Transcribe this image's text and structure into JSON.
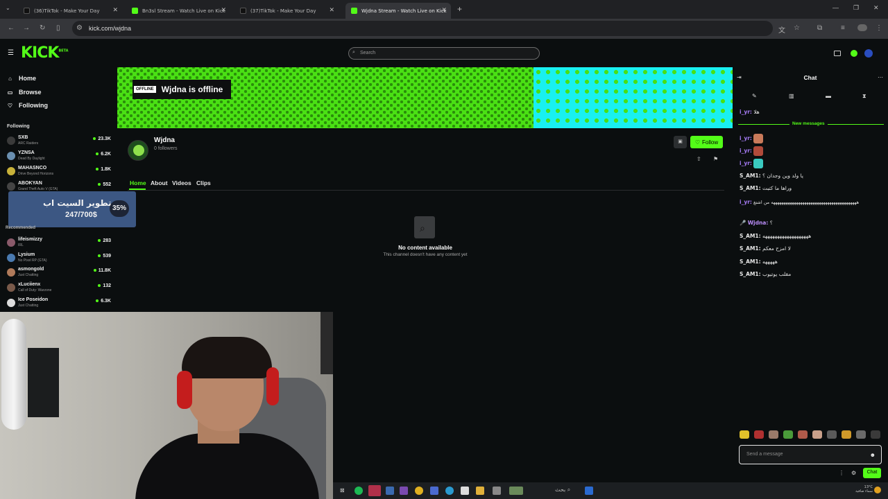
{
  "browser": {
    "tabs": [
      {
        "title": "(36)TikTok - Make Your Day"
      },
      {
        "title": "Bn3sl Stream - Watch Live on Kick"
      },
      {
        "title": "(37)TikTok - Make Your Day"
      },
      {
        "title": "Wjdna Stream - Watch Live on Kick"
      }
    ],
    "url": "kick.com/wjdna"
  },
  "kick": {
    "logo": "KICK",
    "logo_beta": "BETA",
    "search_placeholder": "Search",
    "nav": [
      {
        "label": "Home",
        "icon": "home-icon"
      },
      {
        "label": "Browse",
        "icon": "browse-icon"
      },
      {
        "label": "Following",
        "icon": "heart-icon"
      }
    ],
    "following_heading": "Following",
    "following": [
      {
        "name": "SXB",
        "game": "ARC Raiders",
        "viewers": "23.3K",
        "color": "#3a3a3a"
      },
      {
        "name": "YZNSA",
        "game": "Dead By Daylight",
        "viewers": "6.2K",
        "color": "#6a8fb0"
      },
      {
        "name": "MAHASNCO",
        "game": "Drive Beyond Horizons",
        "viewers": "1.8K",
        "color": "#c8b23a"
      },
      {
        "name": "ABOKYAN",
        "game": "Grand Theft Auto V (GTA)",
        "viewers": "552",
        "color": "#444"
      }
    ],
    "donation": {
      "title": "تطوير السيت اب",
      "amount": "247/700$",
      "percent": "35%",
      "progress": 0.35
    },
    "recommended_heading": "Recommended",
    "recommended": [
      {
        "name": "lifeismizzy",
        "game": "IRL",
        "viewers": "283",
        "color": "#8a5a6a"
      },
      {
        "name": "Lysium",
        "game": "No Pixel RP (GTA)",
        "viewers": "539",
        "color": "#4a7ab0"
      },
      {
        "name": "asmongold",
        "game": "Just Chatting",
        "viewers": "11.8K",
        "color": "#b07a5a"
      },
      {
        "name": "xLuciienx",
        "game": "Call of Duty: Warzone",
        "viewers": "132",
        "color": "#7a5a4a"
      },
      {
        "name": "Ice Poseidon",
        "game": "Just Chatting",
        "viewers": "6.3K",
        "color": "#ddd"
      }
    ],
    "banner": {
      "badge": "OFFLINE",
      "title": "Wjdna is offline"
    },
    "channel": {
      "name": "Wjdna",
      "followers": "0 followers",
      "follow_label": "Follow"
    },
    "channel_tabs": [
      "Home",
      "About",
      "Videos",
      "Clips"
    ],
    "empty": {
      "title": "No content available",
      "subtitle": "This channel doesn't have any content yet"
    }
  },
  "chat": {
    "title": "Chat",
    "new_messages_label": "New messages",
    "messages": [
      {
        "user": "i_yr:",
        "text": "هلا",
        "color": "#a67cf7"
      },
      {
        "user": "i_yr:",
        "text": "",
        "color": "#a67cf7",
        "emote": "#c97a5a"
      },
      {
        "user": "i_yr:",
        "text": "",
        "color": "#a67cf7",
        "emote": "#b04a3a"
      },
      {
        "user": "i_yr:",
        "text": "",
        "color": "#a67cf7",
        "emote": "#3ac9c0"
      },
      {
        "user": "S_AM1:",
        "text": "يا ولد وين وجدان ؟",
        "color": "#e6e6e6"
      },
      {
        "user": "S_AM1:",
        "text": "وراها ما كتبت",
        "color": "#e6e6e6"
      },
      {
        "user": "i_yr:",
        "text": "هههههههههههههههههههههههههههههههههههههههههه من اشتغ",
        "color": "#a67cf7"
      },
      {
        "user": "Wjdna:",
        "text": "؟",
        "color": "#b98cf7"
      },
      {
        "user": "S_AM1:",
        "text": "هههههههههههههههههههه",
        "color": "#e6e6e6"
      },
      {
        "user": "S_AM1:",
        "text": "لا امزح معكم",
        "color": "#e6e6e6"
      },
      {
        "user": "S_AM1:",
        "text": "هههههه",
        "color": "#e6e6e6"
      },
      {
        "user": "S_AM1:",
        "text": "مقلب يوتيوب",
        "color": "#e6e6e6"
      }
    ],
    "send_placeholder": "Send a message",
    "chat_button": "Chat"
  },
  "taskbar": {
    "search_label": "بحث",
    "clock_line1": "13°C",
    "clock_line2": "سماء صافية"
  },
  "colors": {
    "accent": "#53fc18",
    "bg": "#0b0e0f"
  }
}
